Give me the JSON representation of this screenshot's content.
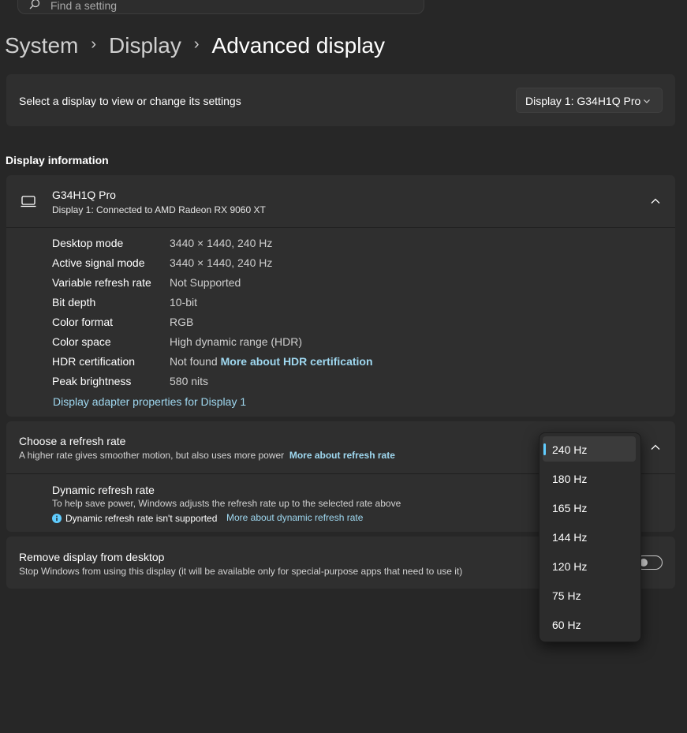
{
  "search": {
    "placeholder": "Find a setting"
  },
  "breadcrumb": {
    "items": [
      "System",
      "Display",
      "Advanced display"
    ]
  },
  "display_selector": {
    "label": "Select a display to view or change its settings",
    "selected": "Display 1: G34H1Q Pro"
  },
  "display_information": {
    "section_title": "Display information",
    "monitor_name": "G34H1Q Pro",
    "monitor_subtitle": "Display 1: Connected to AMD Radeon RX 9060 XT",
    "rows": [
      {
        "label": "Desktop mode",
        "value": "3440 × 1440, 240 Hz"
      },
      {
        "label": "Active signal mode",
        "value": "3440 × 1440, 240 Hz"
      },
      {
        "label": "Variable refresh rate",
        "value": "Not Supported"
      },
      {
        "label": "Bit depth",
        "value": "10-bit"
      },
      {
        "label": "Color format",
        "value": "RGB"
      },
      {
        "label": "Color space",
        "value": "High dynamic range (HDR)"
      },
      {
        "label": "HDR certification",
        "value": "Not found",
        "link": "More about HDR certification"
      },
      {
        "label": "Peak brightness",
        "value": "580 nits"
      }
    ],
    "adapter_link": "Display adapter properties for Display 1"
  },
  "refresh_rate": {
    "title": "Choose a refresh rate",
    "description": "A higher rate gives smoother motion, but also uses more power",
    "link": "More about refresh rate",
    "options": [
      "240 Hz",
      "180 Hz",
      "165 Hz",
      "144 Hz",
      "120 Hz",
      "75 Hz",
      "60 Hz"
    ],
    "selected": "240 Hz",
    "dynamic": {
      "title": "Dynamic refresh rate",
      "description": "To help save power, Windows adjusts the refresh rate up to the selected rate above",
      "warning": "Dynamic refresh rate isn't supported",
      "link": "More about dynamic refresh rate"
    }
  },
  "remove_display": {
    "title": "Remove display from desktop",
    "description": "Stop Windows from using this display (it will be available only for special-purpose apps that need to use it)",
    "toggle_on": false
  },
  "colors": {
    "accent": "#60cdff",
    "link": "#9fd8f0",
    "background": "#272727",
    "card": "#2f2f2f"
  }
}
